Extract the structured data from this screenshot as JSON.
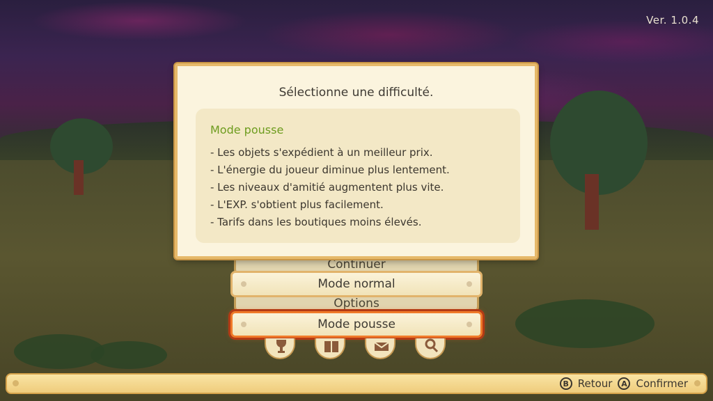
{
  "version": "Ver. 1.0.4",
  "panel": {
    "title": "Sélectionne une difficulté.",
    "mode_title": "Mode pousse",
    "bullets": [
      "- Les objets s'expédient à un meilleur prix.",
      "- L'énergie du joueur diminue plus lentement.",
      "- Les niveaux d'amitié augmentent plus vite.",
      "- L'EXP. s'obtient plus facilement.",
      "- Tarifs dans les boutiques moins élevés."
    ]
  },
  "menu": {
    "background_items": [
      "Continuer",
      "Options"
    ],
    "difficulty_options": [
      "Mode normal",
      "Mode pousse"
    ],
    "selected": "Mode pousse"
  },
  "icons": [
    "trophy-icon",
    "book-icon",
    "mail-icon",
    "magnifier-icon"
  ],
  "hints": [
    {
      "key": "B",
      "label": "Retour"
    },
    {
      "key": "A",
      "label": "Confirmer"
    }
  ],
  "colors": {
    "accent_green": "#6d9c1e",
    "selection_orange": "#f07a2a",
    "panel_border": "#e6b96a"
  }
}
